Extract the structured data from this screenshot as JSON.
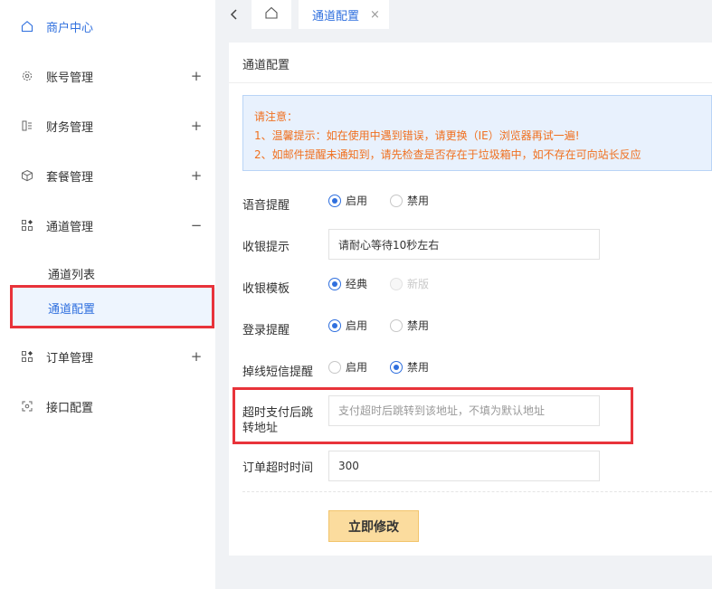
{
  "sidebar": {
    "home": "商户中心",
    "account": "账号管理",
    "finance": "财务管理",
    "package": "套餐管理",
    "channel": "通道管理",
    "channel_list": "通道列表",
    "channel_config": "通道配置",
    "order": "订单管理",
    "api": "接口配置",
    "expand_symbol": "+",
    "collapse_symbol": "−"
  },
  "tabs": {
    "active_label": "通道配置",
    "close_symbol": "×"
  },
  "card": {
    "title": "通道配置"
  },
  "notice": {
    "heading": "请注意：",
    "line1": "1、温馨提示：如在使用中遇到错误，请更换（IE）浏览器再试一遍!",
    "line2": "2、如邮件提醒未通知到，请先检查是否存在于垃圾箱中，如不存在可向站长反应"
  },
  "form": {
    "voice_label": "语音提醒",
    "voice_on": "启用",
    "voice_off": "禁用",
    "cashier_tip_label": "收银提示",
    "cashier_tip_value": "请耐心等待10秒左右",
    "template_label": "收银模板",
    "template_classic": "经典",
    "template_new": "新版",
    "login_label": "登录提醒",
    "login_on": "启用",
    "login_off": "禁用",
    "sms_label": "掉线短信提醒",
    "sms_on": "启用",
    "sms_off": "禁用",
    "redirect_label_line1": "超时支付后跳",
    "redirect_label_line2": "转地址",
    "redirect_placeholder": "支付超时后跳转到该地址，不填为默认地址",
    "timeout_label": "订单超时时间",
    "timeout_value": "300",
    "submit_label": "立即修改"
  },
  "colors": {
    "accent": "#2f6fde",
    "highlight_box": "#e8333a",
    "notice_text": "#f0701f",
    "submit_bg": "#fbdc9e"
  }
}
